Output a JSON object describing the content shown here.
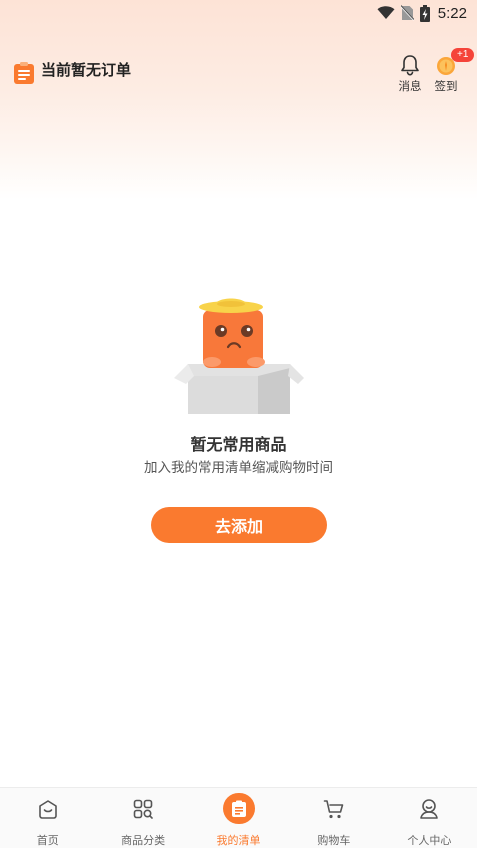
{
  "status_bar": {
    "time": "5:22",
    "icons": [
      "wifi-icon",
      "no-sim-icon",
      "battery-charging-icon"
    ]
  },
  "header": {
    "title": "当前暂无订单",
    "messages_label": "消息",
    "checkin_label": "签到",
    "checkin_badge": "+1"
  },
  "empty_state": {
    "title": "暂无常用商品",
    "subtitle": "加入我的常用清单缩减购物时间",
    "button_label": "去添加"
  },
  "bottom_nav": {
    "items": [
      {
        "label": "首页",
        "icon": "home-icon",
        "active": false
      },
      {
        "label": "商品分类",
        "icon": "category-grid-icon",
        "active": false
      },
      {
        "label": "我的清单",
        "icon": "list-icon",
        "active": true
      },
      {
        "label": "购物车",
        "icon": "cart-icon",
        "active": false
      },
      {
        "label": "个人中心",
        "icon": "profile-icon",
        "active": false
      }
    ]
  },
  "colors": {
    "accent": "#fa7a2f",
    "badge": "#f5443a",
    "header_gradient_top": "#fde3d6"
  }
}
